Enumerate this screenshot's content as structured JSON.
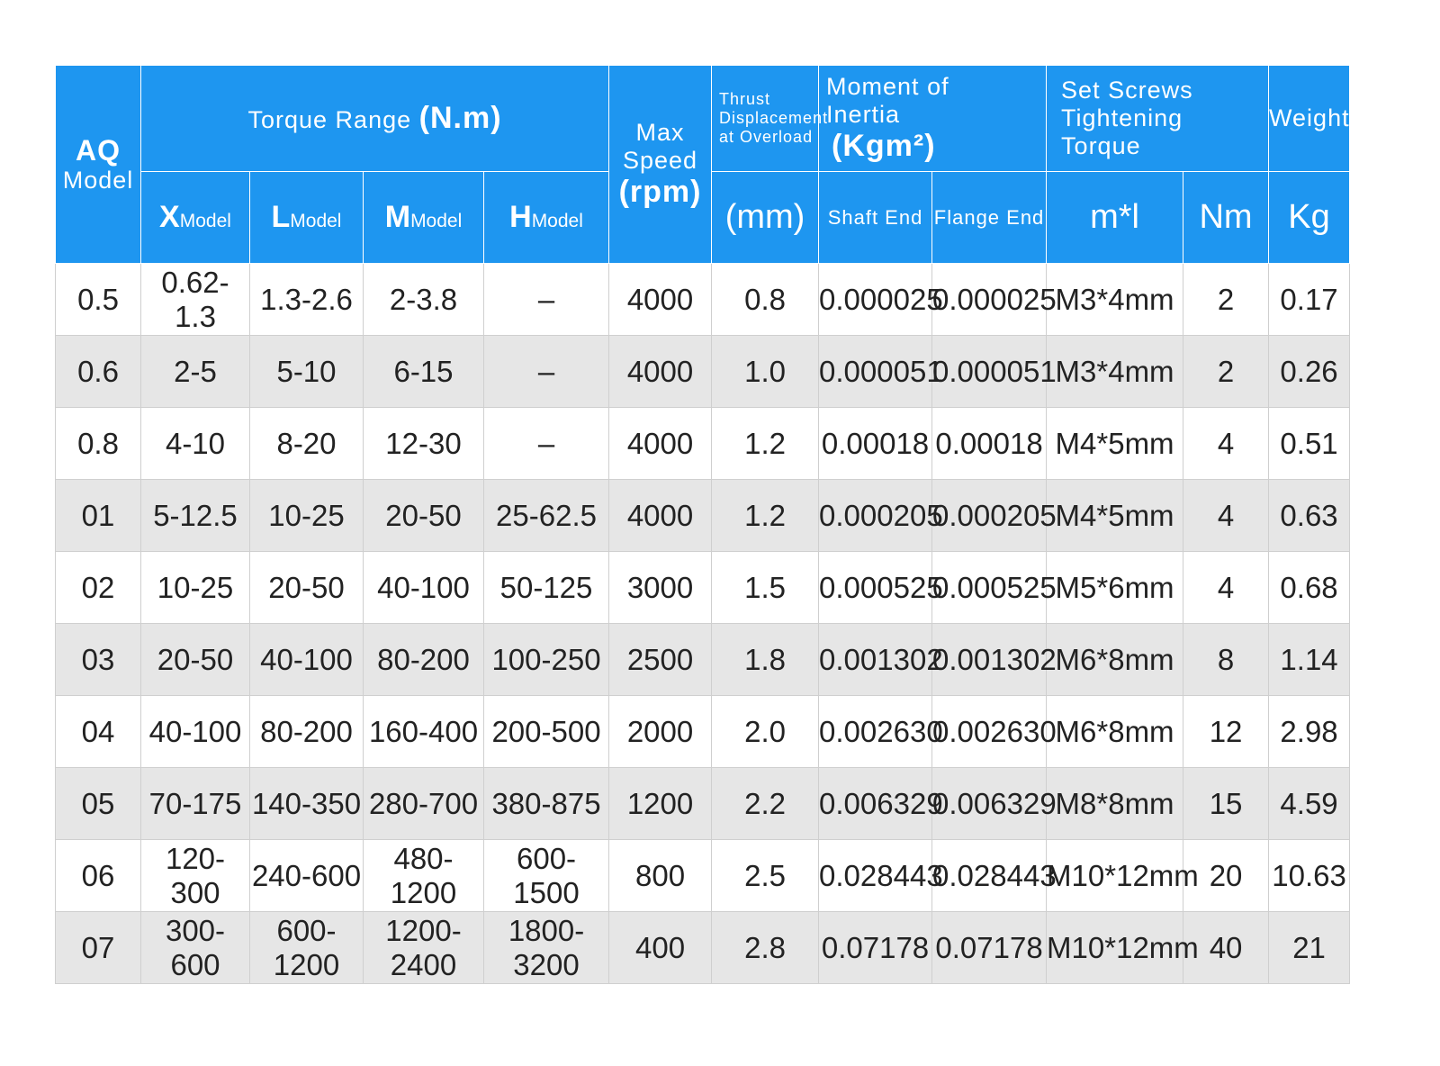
{
  "header": {
    "aq_model": [
      "AQ",
      "Model"
    ],
    "torque_range": "Torque Range",
    "torque_unit": "(N.m)",
    "x_letter": "X",
    "l_letter": "L",
    "m_letter": "M",
    "h_letter": "H",
    "model_word": "Model",
    "max_speed": [
      "Max",
      "Speed",
      "(rpm)"
    ],
    "thrust": [
      "Thrust",
      "Displacement",
      "at Overload"
    ],
    "thrust_unit": "(mm)",
    "moment": [
      "Moment of",
      "Inertia"
    ],
    "moment_unit": "(Kgm²)",
    "shaft_end": "Shaft End",
    "flange_end": "Flange End",
    "set_screws": [
      "Set Screws",
      "Tightening Torque"
    ],
    "ml_unit": "m*l",
    "nm_unit": "Nm",
    "weight": "Weight",
    "kg_unit": "Kg"
  },
  "rows": [
    [
      "0.5",
      "0.62-1.3",
      "1.3-2.6",
      "2-3.8",
      "–",
      "4000",
      "0.8",
      "0.000025",
      "0.000025",
      "M3*4mm",
      "2",
      "0.17"
    ],
    [
      "0.6",
      "2-5",
      "5-10",
      "6-15",
      "–",
      "4000",
      "1.0",
      "0.000051",
      "0.000051",
      "M3*4mm",
      "2",
      "0.26"
    ],
    [
      "0.8",
      "4-10",
      "8-20",
      "12-30",
      "–",
      "4000",
      "1.2",
      "0.00018",
      "0.00018",
      "M4*5mm",
      "4",
      "0.51"
    ],
    [
      "01",
      "5-12.5",
      "10-25",
      "20-50",
      "25-62.5",
      "4000",
      "1.2",
      "0.000205",
      "0.000205",
      "M4*5mm",
      "4",
      "0.63"
    ],
    [
      "02",
      "10-25",
      "20-50",
      "40-100",
      "50-125",
      "3000",
      "1.5",
      "0.000525",
      "0.000525",
      "M5*6mm",
      "4",
      "0.68"
    ],
    [
      "03",
      "20-50",
      "40-100",
      "80-200",
      "100-250",
      "2500",
      "1.8",
      "0.001302",
      "0.001302",
      "M6*8mm",
      "8",
      "1.14"
    ],
    [
      "04",
      "40-100",
      "80-200",
      "160-400",
      "200-500",
      "2000",
      "2.0",
      "0.002630",
      "0.002630",
      "M6*8mm",
      "12",
      "2.98"
    ],
    [
      "05",
      "70-175",
      "140-350",
      "280-700",
      "380-875",
      "1200",
      "2.2",
      "0.006329",
      "0.006329",
      "M8*8mm",
      "15",
      "4.59"
    ],
    [
      "06",
      "120-300",
      "240-600",
      "480-1200",
      "600-1500",
      "800",
      "2.5",
      "0.028443",
      "0.028443",
      "M10*12mm",
      "20",
      "10.63"
    ],
    [
      "07",
      "300-600",
      "600-1200",
      "1200-2400",
      "1800-3200",
      "400",
      "2.8",
      "0.07178",
      "0.07178",
      "M10*12mm",
      "40",
      "21"
    ]
  ]
}
